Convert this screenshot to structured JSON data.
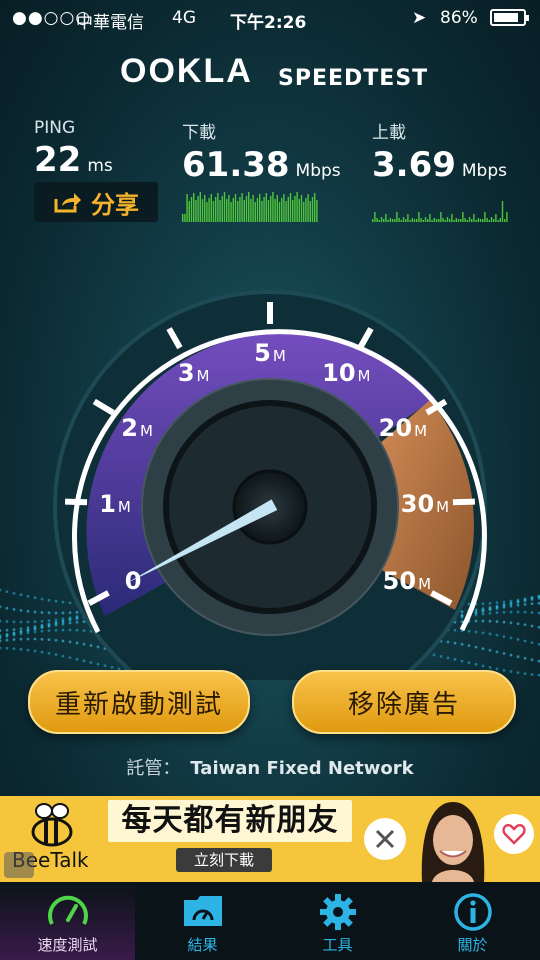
{
  "status_bar": {
    "signal": "●●○○○",
    "carrier": "中華電信",
    "network": "4G",
    "time": "下午2:26",
    "battery": "86%",
    "battery_level": 0.86
  },
  "header": {
    "brand": "OOKLA",
    "product": "SPEEDTEST"
  },
  "stats": {
    "ping": {
      "label": "PING",
      "value": "22",
      "unit": "ms"
    },
    "download": {
      "label": "下載",
      "value": "61.38",
      "unit": "Mbps"
    },
    "upload": {
      "label": "上載",
      "value": "3.69",
      "unit": "Mbps"
    }
  },
  "share_label": "分享",
  "gauge": {
    "ticks": [
      {
        "num": "0",
        "unit": ""
      },
      {
        "num": "1",
        "unit": "M"
      },
      {
        "num": "2",
        "unit": "M"
      },
      {
        "num": "3",
        "unit": "M"
      },
      {
        "num": "5",
        "unit": "M"
      },
      {
        "num": "10",
        "unit": "M"
      },
      {
        "num": "20",
        "unit": "M"
      },
      {
        "num": "30",
        "unit": "M"
      },
      {
        "num": "50",
        "unit": "M"
      }
    ],
    "needle_value_mbps": 0
  },
  "buttons": {
    "restart": "重新啟動測試",
    "remove_ads": "移除廣告"
  },
  "host": {
    "label": "託管：",
    "name": "Taiwan Fixed Network"
  },
  "ad": {
    "title": "每天都有新朋友",
    "download": "立刻下載",
    "brand": "BeeTalk"
  },
  "tabs": [
    {
      "label": "速度測試",
      "icon": "speedometer-icon",
      "active": true
    },
    {
      "label": "結果",
      "icon": "results-folder-icon",
      "active": false
    },
    {
      "label": "工具",
      "icon": "gear-icon",
      "active": false
    },
    {
      "label": "關於",
      "icon": "info-icon",
      "active": false
    }
  ],
  "colors": {
    "accent": "#f3b32a",
    "tab_blue": "#2db4e5",
    "gauge_purple": "#6a3fb0"
  }
}
